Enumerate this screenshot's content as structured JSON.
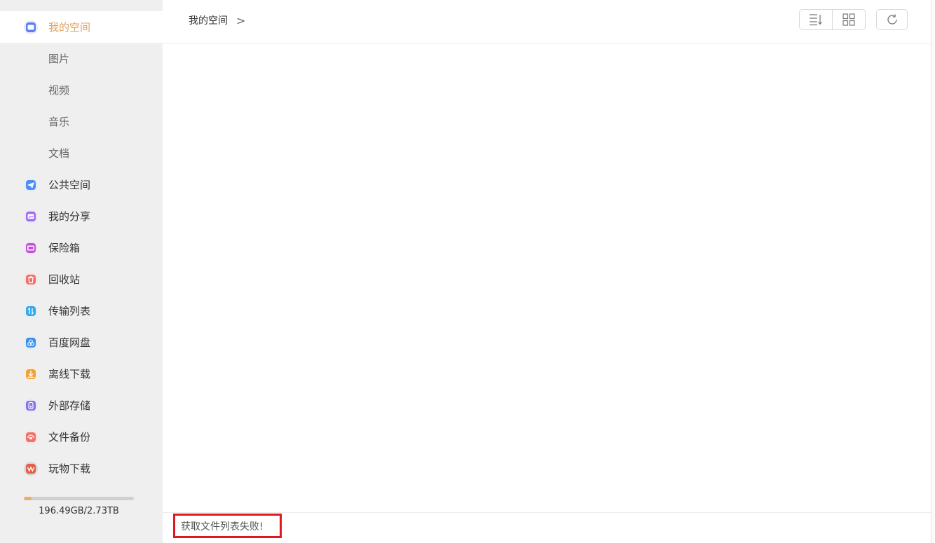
{
  "sidebar": {
    "items": [
      {
        "label": "我的空间",
        "icon": "my-space-icon",
        "active": true,
        "sub": false,
        "color": "#5b7ff0"
      },
      {
        "label": "图片",
        "icon": "",
        "active": false,
        "sub": true,
        "color": ""
      },
      {
        "label": "视频",
        "icon": "",
        "active": false,
        "sub": true,
        "color": ""
      },
      {
        "label": "音乐",
        "icon": "",
        "active": false,
        "sub": true,
        "color": ""
      },
      {
        "label": "文档",
        "icon": "",
        "active": false,
        "sub": true,
        "color": ""
      },
      {
        "label": "公共空间",
        "icon": "paper-plane-icon",
        "active": false,
        "sub": false,
        "color": "#4f8df5"
      },
      {
        "label": "我的分享",
        "icon": "share-icon",
        "active": false,
        "sub": false,
        "color": "#9b6cf0"
      },
      {
        "label": "保险箱",
        "icon": "safe-icon",
        "active": false,
        "sub": false,
        "color": "#c251d6"
      },
      {
        "label": "回收站",
        "icon": "trash-icon",
        "active": false,
        "sub": false,
        "color": "#f0706a"
      },
      {
        "label": "传输列表",
        "icon": "transfer-icon",
        "active": false,
        "sub": false,
        "color": "#3ba7e8"
      },
      {
        "label": "百度网盘",
        "icon": "baidu-cloud-icon",
        "active": false,
        "sub": false,
        "color": "#3b8fe8"
      },
      {
        "label": "离线下载",
        "icon": "offline-download-icon",
        "active": false,
        "sub": false,
        "color": "#f0a23a"
      },
      {
        "label": "外部存储",
        "icon": "external-storage-icon",
        "active": false,
        "sub": false,
        "color": "#8c73e6"
      },
      {
        "label": "文件备份",
        "icon": "file-backup-icon",
        "active": false,
        "sub": false,
        "color": "#f0736a"
      },
      {
        "label": "玩物下载",
        "icon": "wanwu-download-icon",
        "active": false,
        "sub": false,
        "color": "#e0604a"
      }
    ],
    "storage": {
      "text": "196.49GB/2.73TB",
      "used_fraction": 0.07
    }
  },
  "header": {
    "breadcrumb": "我的空间",
    "breadcrumb_arrow": ">",
    "icons": {
      "sort": "sort-list-icon",
      "grid": "grid-view-icon",
      "refresh": "refresh-icon"
    }
  },
  "footer": {
    "error_text": "获取文件列表失败!"
  }
}
